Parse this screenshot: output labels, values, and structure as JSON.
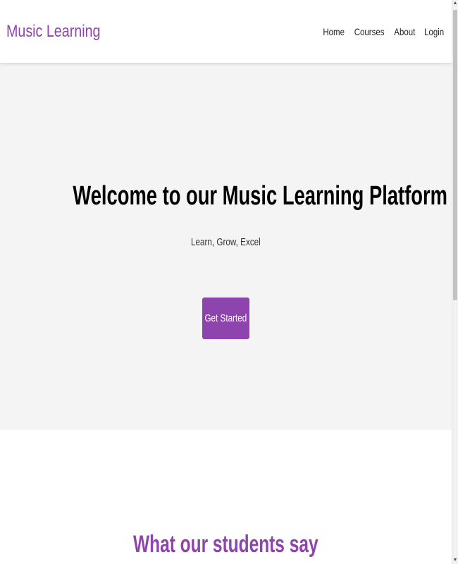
{
  "navbar": {
    "brand": "Music Learning",
    "links": [
      "Home",
      "Courses",
      "About",
      "Login"
    ]
  },
  "hero": {
    "title": "Welcome to our Music Learning Platform",
    "subtitle": "Learn, Grow, Excel",
    "cta_label": "Get Started"
  },
  "testimonials": {
    "title": "What our students say"
  },
  "scrollbar": {
    "up_glyph": "▲",
    "down_glyph": "▼"
  },
  "colors": {
    "accent": "#8e44ad",
    "hero_background": "#f4f4f4",
    "page_background": "#ffffff"
  }
}
